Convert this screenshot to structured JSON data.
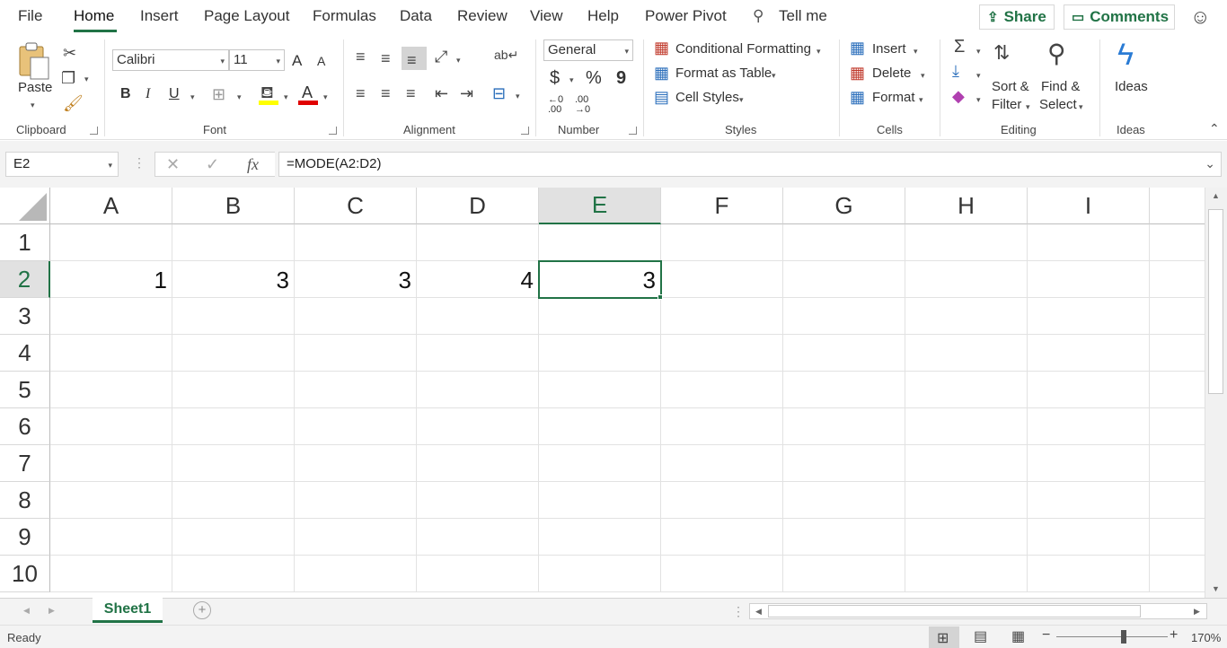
{
  "menu": {
    "tabs": [
      "File",
      "Home",
      "Insert",
      "Page Layout",
      "Formulas",
      "Data",
      "Review",
      "View",
      "Help",
      "Power Pivot"
    ],
    "tell_me": "Tell me",
    "share": "Share",
    "comments": "Comments"
  },
  "ribbon": {
    "clipboard": {
      "paste": "Paste",
      "label": "Clipboard"
    },
    "font": {
      "name": "Calibri",
      "size": "11",
      "label": "Font",
      "bold": "B",
      "italic": "I",
      "underline": "U",
      "grow": "A",
      "shrink": "A",
      "font_color_letter": "A",
      "highlight_color": "#ffff00",
      "font_color": "#e00000"
    },
    "alignment": {
      "label": "Alignment"
    },
    "number": {
      "format": "General",
      "currency": "$",
      "percent": "%",
      "comma": "9",
      "inc_dec": "←0 .00",
      "dec_dec": ".00 →0",
      "label": "Number"
    },
    "styles": {
      "conditional": "Conditional Formatting",
      "table": "Format as Table",
      "cell_styles": "Cell Styles",
      "label": "Styles"
    },
    "cells": {
      "insert": "Insert",
      "delete": "Delete",
      "format": "Format",
      "label": "Cells"
    },
    "editing": {
      "sort_filter_1": "Sort &",
      "sort_filter_2": "Filter",
      "find_select_1": "Find &",
      "find_select_2": "Select",
      "label": "Editing"
    },
    "ideas": {
      "button": "Ideas",
      "label": "Ideas"
    }
  },
  "formula_bar": {
    "name_box": "E2",
    "fx": "fx",
    "formula": "=MODE(A2:D2)"
  },
  "sheet": {
    "columns": [
      "A",
      "B",
      "C",
      "D",
      "E",
      "F",
      "G",
      "H",
      "I"
    ],
    "rows": [
      "1",
      "2",
      "3",
      "4",
      "5",
      "6",
      "7",
      "8",
      "9",
      "10"
    ],
    "selected_cell": "E2",
    "row2": [
      "1",
      "3",
      "3",
      "4",
      "3"
    ]
  },
  "tabs": {
    "sheet1": "Sheet1"
  },
  "status": {
    "ready": "Ready",
    "zoom": "170%"
  },
  "colors": {
    "accent": "#217346"
  }
}
